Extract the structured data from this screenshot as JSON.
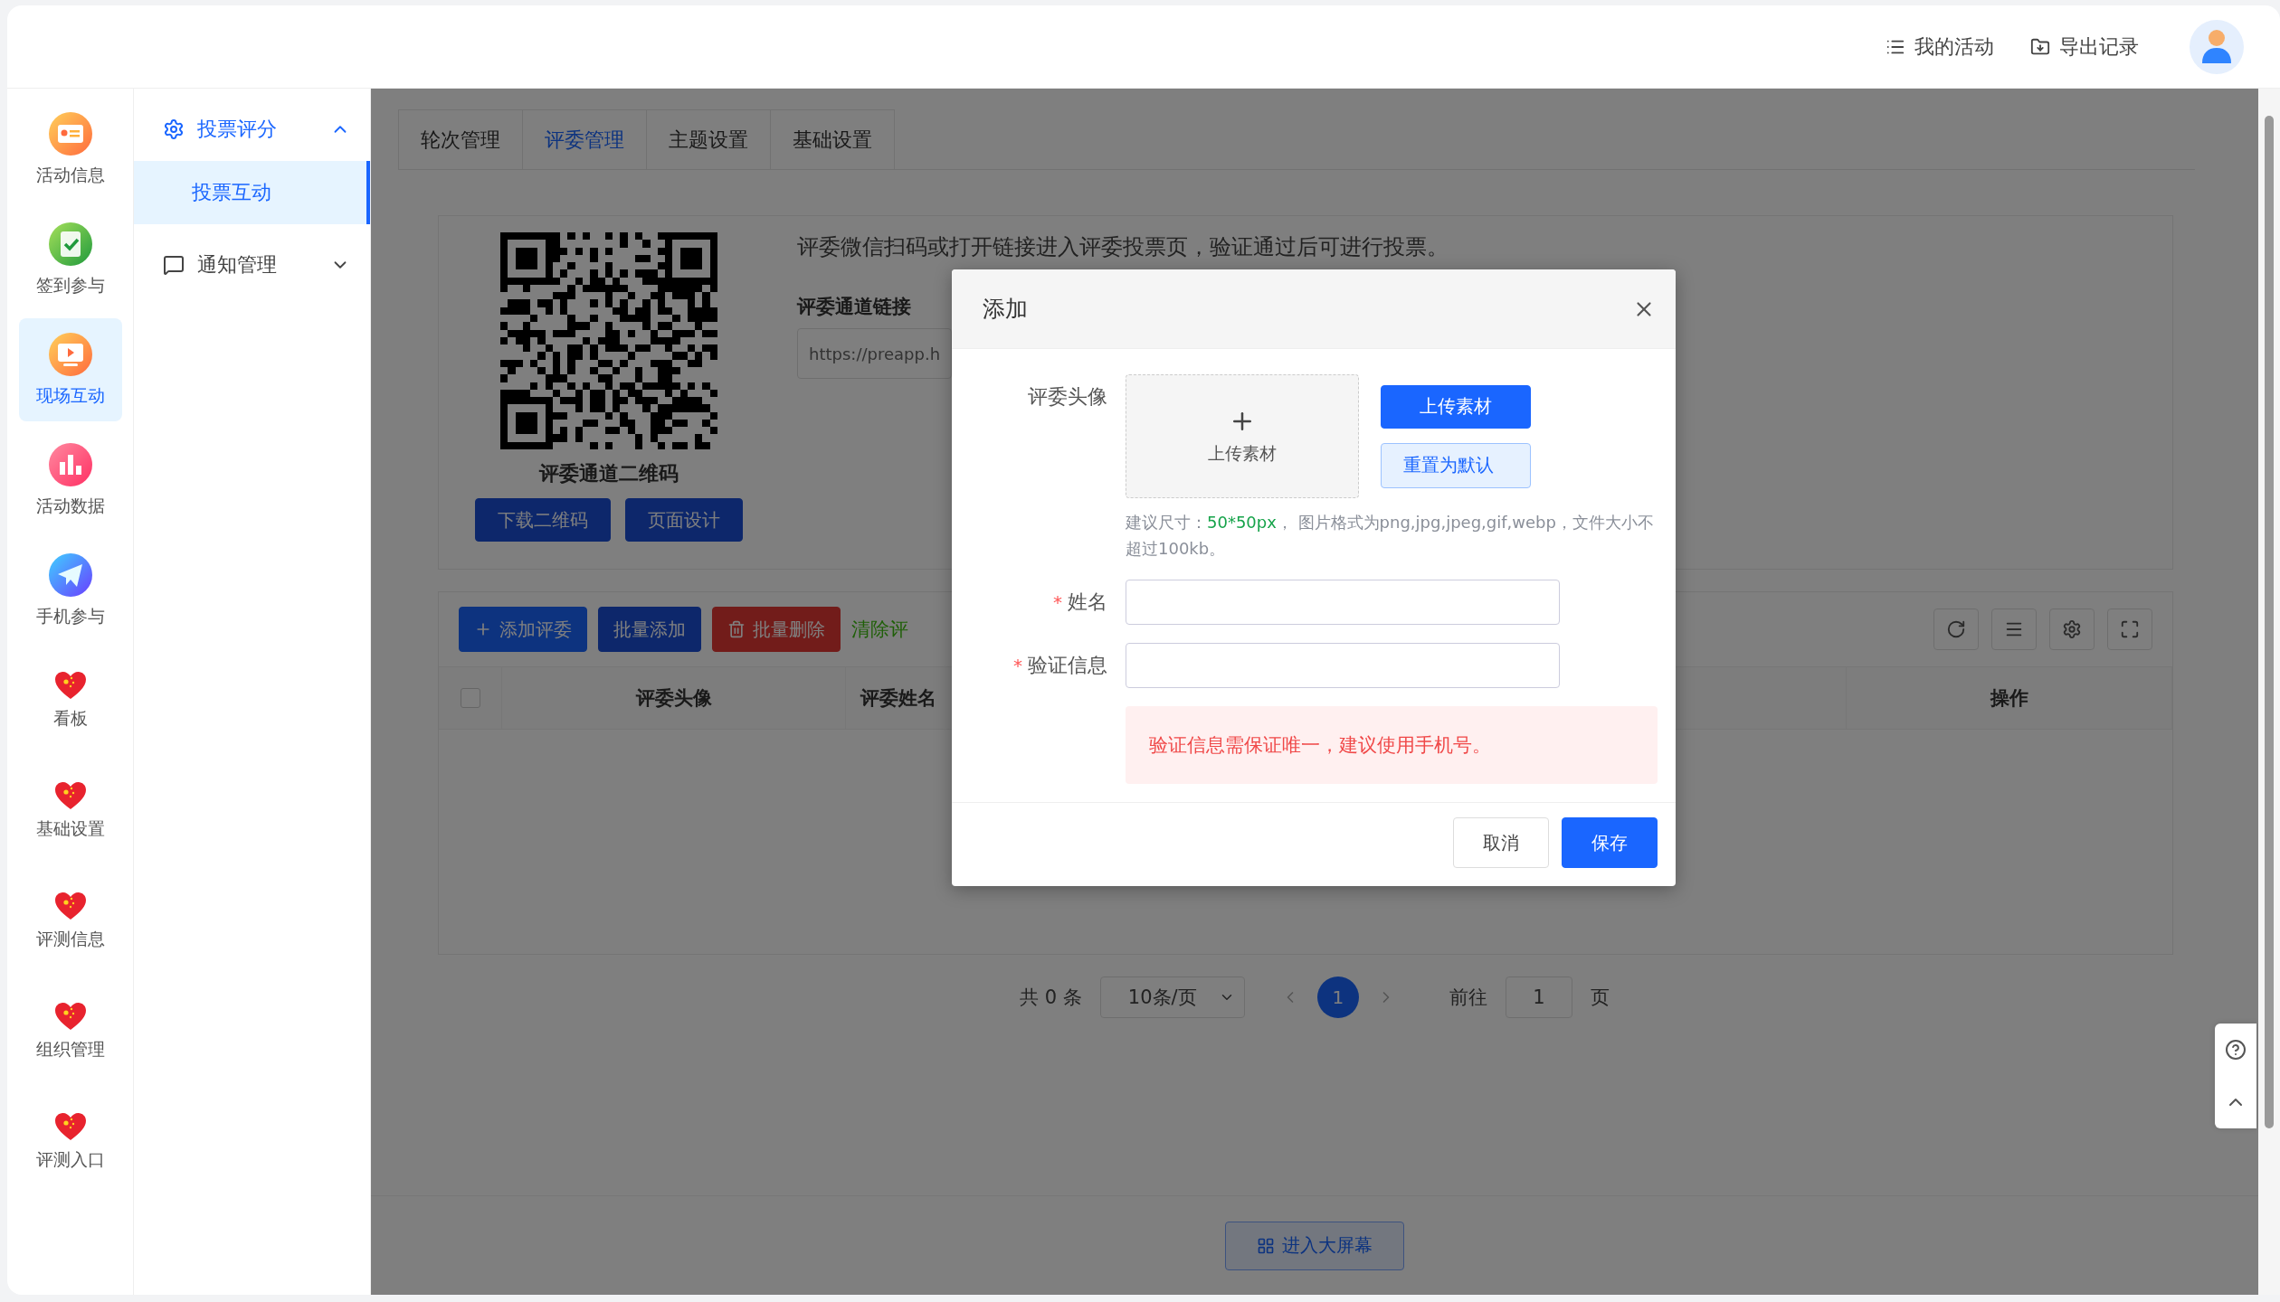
{
  "header": {
    "links": [
      {
        "label": "我的活动",
        "kind": "list"
      },
      {
        "label": "导出记录",
        "kind": "export"
      }
    ]
  },
  "rail": [
    {
      "label": "活动信息",
      "kind": "card",
      "selected": false
    },
    {
      "label": "签到参与",
      "kind": "clipboard",
      "selected": false
    },
    {
      "label": "现场互动",
      "kind": "screen",
      "selected": true
    },
    {
      "label": "活动数据",
      "kind": "chart",
      "selected": false
    },
    {
      "label": "手机参与",
      "kind": "plane",
      "selected": false
    },
    {
      "label": "看板",
      "kind": "heart",
      "selected": false
    },
    {
      "label": "基础设置",
      "kind": "heart",
      "selected": false
    },
    {
      "label": "评测信息",
      "kind": "heart",
      "selected": false
    },
    {
      "label": "组织管理",
      "kind": "heart",
      "selected": false
    },
    {
      "label": "评测入口",
      "kind": "heart",
      "selected": false
    }
  ],
  "submenu": [
    {
      "label": "投票评分",
      "kind": "gear",
      "expanded": true,
      "children": [
        {
          "label": "投票互动",
          "selected": true
        }
      ]
    },
    {
      "label": "通知管理",
      "kind": "chat",
      "expanded": false
    }
  ],
  "tabs": [
    {
      "label": "轮次管理",
      "selected": false
    },
    {
      "label": "评委管理",
      "selected": true
    },
    {
      "label": "主题设置",
      "selected": false
    },
    {
      "label": "基础设置",
      "selected": false
    }
  ],
  "qr_panel": {
    "caption": "评委通道二维码",
    "buttons": [
      "下载二维码",
      "页面设计"
    ],
    "intro": "评委微信扫码或打开链接进入评委投票页，验证通过后可进行投票。",
    "link_label": "评委通道链接",
    "link_value": "https://preapp.h"
  },
  "toolbar": {
    "buttons": [
      {
        "label": "添加评委",
        "kind": "add"
      },
      {
        "label": "批量添加",
        "kind": "primary"
      },
      {
        "label": "批量删除",
        "kind": "danger"
      },
      {
        "label": "清除评",
        "kind": "text"
      }
    ],
    "tools": [
      {
        "kind": "refresh"
      },
      {
        "kind": "columns"
      },
      {
        "kind": "settings"
      },
      {
        "kind": "fullscreen"
      }
    ]
  },
  "table": {
    "all_checked": false,
    "columns": [
      "评委头像",
      "评委姓名",
      "操作"
    ]
  },
  "pagination": {
    "total": "共 0 条",
    "page_size": "10条/页",
    "pages": [
      {
        "label": "1",
        "selected": true
      }
    ],
    "goto_label": "前往",
    "goto_value": "1",
    "goto_suffix": "页"
  },
  "big_screen_button": "进入大屏幕",
  "dialog": {
    "title": "添加",
    "avatar_label": "评委头像",
    "upload_tile": "上传素材",
    "upload_button": "上传素材",
    "reset_button": "重置为默认",
    "hint_prefix": "建议尺寸：",
    "hint_size": "50*50px",
    "hint_rest": "， 图片格式为png,jpg,jpeg,gif,webp，文件大小不超过100kb。",
    "fields": [
      {
        "label": "姓名",
        "required_mark": "*"
      },
      {
        "label": "验证信息",
        "required_mark": "*"
      }
    ],
    "alert": "验证信息需保证唯一，建议使用手机号。",
    "cancel": "取消",
    "save": "保存"
  }
}
